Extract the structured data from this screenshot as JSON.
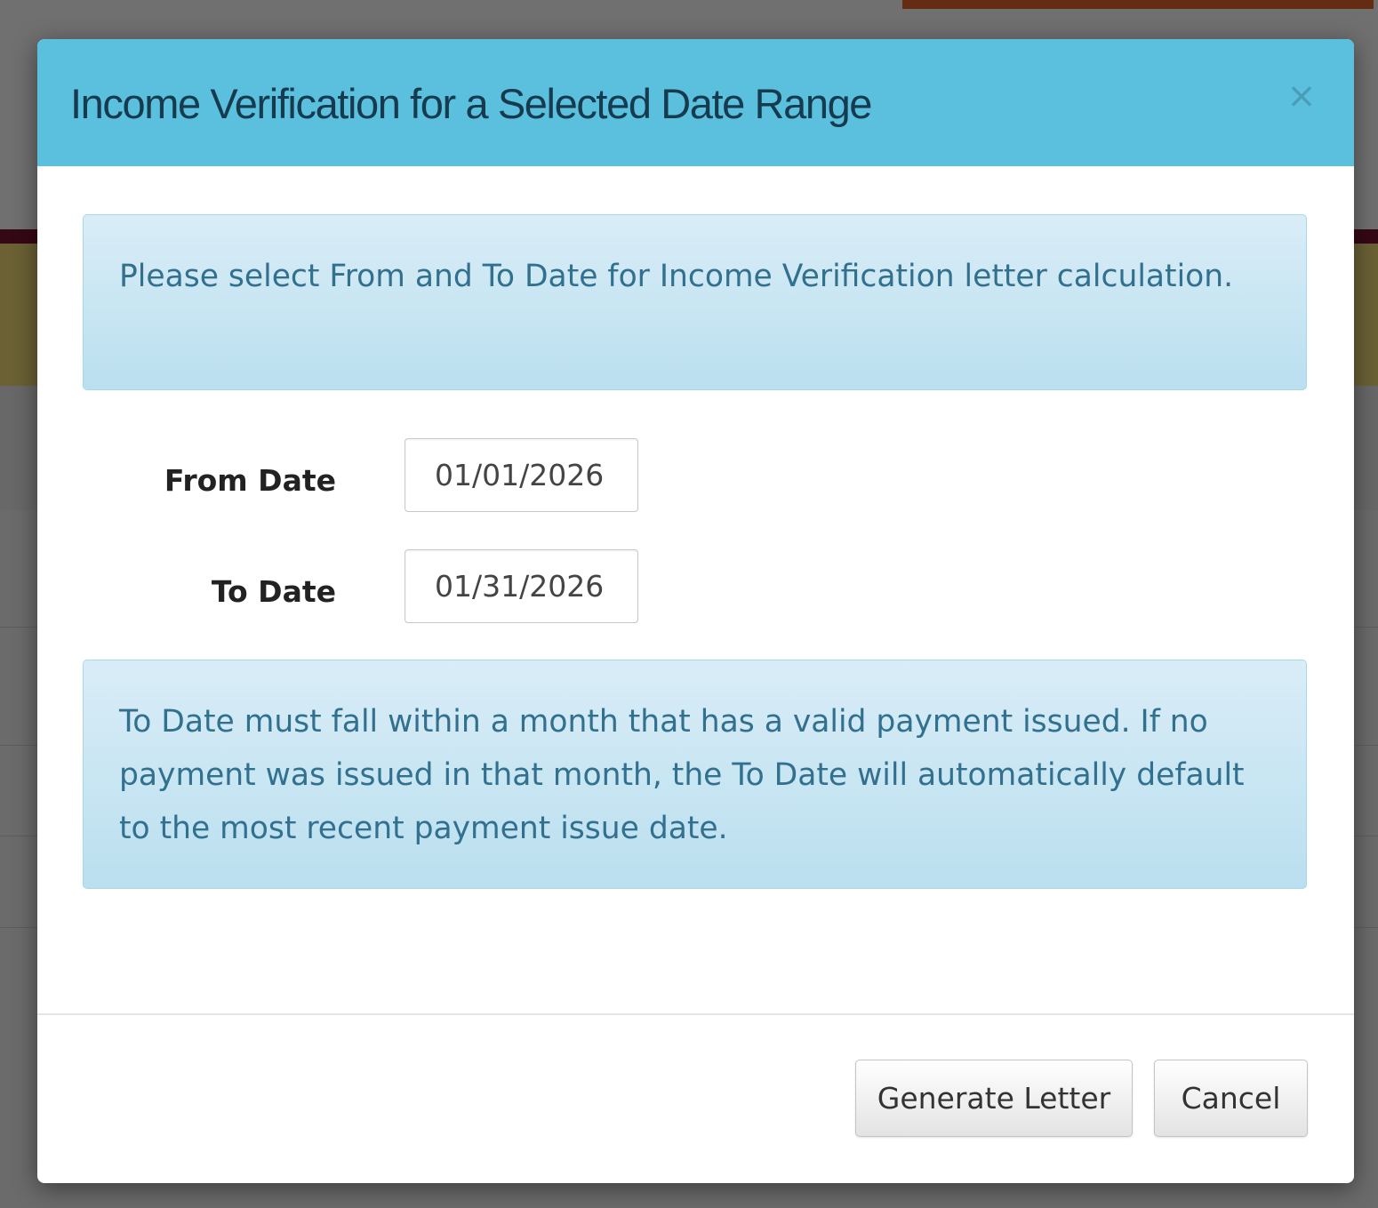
{
  "modal": {
    "title": "Income Verification for a Selected Date Range",
    "close_glyph": "×",
    "info_message": "Please select From and To Date for Income Verification letter calculation.",
    "form": {
      "from_date": {
        "label": "From Date",
        "value": "01/01/2026"
      },
      "to_date": {
        "label": "To Date",
        "value": "01/31/2026"
      }
    },
    "notice_message": "To Date must fall within a month that has a valid payment issued. If no payment was issued in that month, the To Date will automatically default to the most recent payment issue date.",
    "footer": {
      "generate_label": "Generate Letter",
      "cancel_label": "Cancel"
    }
  },
  "colors": {
    "header_background": "#5bc0de",
    "alert_background": "#d9edf7",
    "alert_text": "#31708f",
    "backdrop": "rgba(0,0,0,0.56)"
  }
}
